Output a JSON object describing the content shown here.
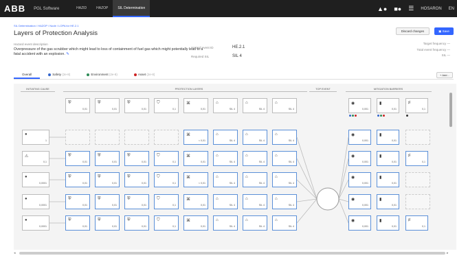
{
  "topbar": {
    "logo": "ABB",
    "app_name": "PGL Software",
    "tabs": [
      "HAZID",
      "HAZOP",
      "SIL Determination"
    ],
    "active_tab": 2,
    "username": "HOSARON",
    "lang": "EN"
  },
  "breadcrumb": "SIL Determination / HAZOP / Node / LOPA for HE.2.1",
  "page_title": "Layers of Protection Analysis",
  "buttons": {
    "discard": "Discard changes",
    "save": "Save"
  },
  "hazard": {
    "label": "Hazard event description",
    "text": "Overpressure of the gas scrubber which might lead to loss of containment of fuel gas which might potentially lead to a fatal accident with an explosion."
  },
  "fields": {
    "event_label": "Hazard event ID",
    "event_value": "HE.2.1",
    "sil_label": "Required SIL",
    "sil_value": "SIL 4"
  },
  "right_fields": {
    "target_frequency": "Target frequency",
    "total_event_frequency": "Total event frequency",
    "sil": "SIL",
    "dash": "—"
  },
  "tabs": {
    "overall": "Overall",
    "safety": "Safety",
    "safety_count": "(2e-8)",
    "environment": "Environment",
    "environment_count": "(2e-8)",
    "asset": "Asset",
    "asset_count": "(2e-8)",
    "add": "+ Add..."
  },
  "sections": {
    "initiating": "INITIATING CAUSE",
    "layers": "PROTECTION LAYERS",
    "top": "TOP EVENT",
    "mitigation": "MITIGATION BARRIERS"
  },
  "header_layers": [
    "0,01",
    "0,01",
    "0,01",
    "0,1",
    "0,01",
    "SIL 4",
    "SIL 4",
    "SIL 4"
  ],
  "header_mitig": [
    "0,001",
    "0,01",
    "0,1"
  ],
  "rows": [
    {
      "cause": "1",
      "layers": [
        "",
        "",
        "",
        "",
        "< 0,01",
        "SIL 4",
        "SIL 4",
        "SIL 4"
      ],
      "mitig": [
        "0,001",
        "0,01",
        ""
      ]
    },
    {
      "cause": "0,1",
      "layers": [
        "0,01",
        "0,01",
        "0,01",
        "0,1",
        "0,01",
        "SIL 4",
        "SIL 4",
        "SIL 4"
      ],
      "mitig": [
        "0,001",
        "0,01",
        "0,1"
      ]
    },
    {
      "cause": "0,0001",
      "layers": [
        "0,01",
        "0,01",
        "0,01",
        "0,1",
        "< 0,01",
        "SIL 4",
        "SIL 4",
        "SIL 4"
      ],
      "mitig": [
        "0,001",
        "0,01",
        ""
      ]
    },
    {
      "cause": "0,0001",
      "layers": [
        "0,01",
        "0,01",
        "0,01",
        "0,1",
        "0,01",
        "SIL 4",
        "SIL 4",
        "SIL 4"
      ],
      "mitig": [
        "0,001",
        "0,01",
        ""
      ]
    },
    {
      "cause": "0,0001",
      "layers": [
        "0,01",
        "0,01",
        "0,01",
        "0,1",
        "0,01",
        "SIL 4",
        "SIL 4",
        "SIL 4"
      ],
      "mitig": [
        "0,001",
        "0,01",
        "0,1"
      ]
    },
    {
      "cause": "0,0001",
      "layers": [
        "0,01",
        "0,01",
        "0,01",
        "0,1",
        "0,01",
        "SIL 4",
        "SIL 4",
        "SIL 4"
      ],
      "mitig": [
        "0,001",
        "0,01",
        ""
      ]
    }
  ],
  "colors": {
    "accent": "#3366ff",
    "safety": "#3366cc",
    "environment": "#2e8b57",
    "asset": "#cc2222"
  }
}
